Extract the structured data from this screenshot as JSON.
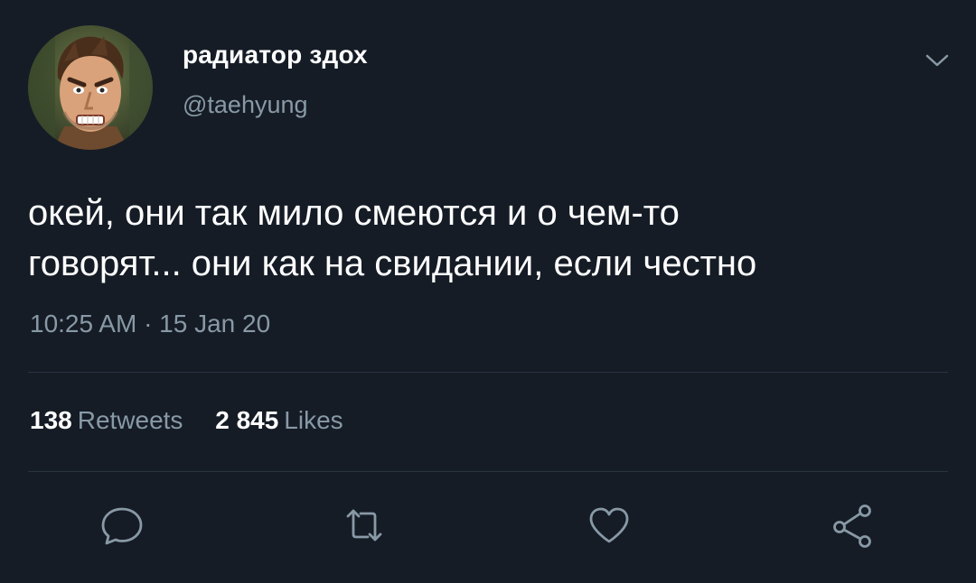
{
  "tweet": {
    "author": {
      "display_name": "радиатор здох",
      "handle": "@taehyung",
      "avatar_icon": "cartoon-portrait-avatar"
    },
    "text_line1": "окей, они так мило смеются и о чем-то",
    "text_line2": "говорят... они как на свидании, если честно",
    "timestamp": "10:25 AM · 15 Jan 20",
    "stats": {
      "retweets_count": "138",
      "retweets_label": "Retweets",
      "likes_count": "2 845",
      "likes_label": "Likes"
    },
    "actions": [
      "reply-icon",
      "retweet-icon",
      "like-icon",
      "share-icon"
    ]
  },
  "colors": {
    "background": "#151c26",
    "primary_text": "#ffffff",
    "secondary_text": "#8899a6",
    "divider": "#2a3440"
  }
}
